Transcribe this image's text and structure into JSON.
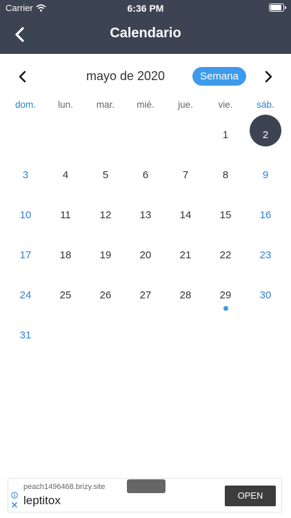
{
  "status_bar": {
    "carrier": "Carrier",
    "time": "6:36 PM"
  },
  "header": {
    "title": "Calendario"
  },
  "calendar": {
    "month_label": "mayo de 2020",
    "view_button": "Semana",
    "weekdays": [
      "dom.",
      "lun.",
      "mar.",
      "mié.",
      "jue.",
      "vie.",
      "sáb."
    ],
    "days": [
      [
        "",
        "",
        "",
        "",
        "",
        "1",
        "2"
      ],
      [
        "3",
        "4",
        "5",
        "6",
        "7",
        "8",
        "9"
      ],
      [
        "10",
        "11",
        "12",
        "13",
        "14",
        "15",
        "16"
      ],
      [
        "17",
        "18",
        "19",
        "20",
        "21",
        "22",
        "23"
      ],
      [
        "24",
        "25",
        "26",
        "27",
        "28",
        "29",
        "30"
      ],
      [
        "31",
        "",
        "",
        "",
        "",
        "",
        ""
      ]
    ],
    "selected_day": "2",
    "event_days": [
      "29"
    ],
    "colors": {
      "header": "#3c4352",
      "accent": "#3e9bea",
      "weekend": "#2f80d0"
    }
  },
  "ad": {
    "url": "peach1496468.brizy.site",
    "name": "leptitox",
    "button": "OPEN"
  },
  "icons": {
    "back": "chevron-left-icon",
    "prev": "chevron-left-icon",
    "next": "chevron-right-icon",
    "wifi": "wifi-icon",
    "battery": "battery-icon",
    "info": "info-icon",
    "close": "close-icon"
  }
}
